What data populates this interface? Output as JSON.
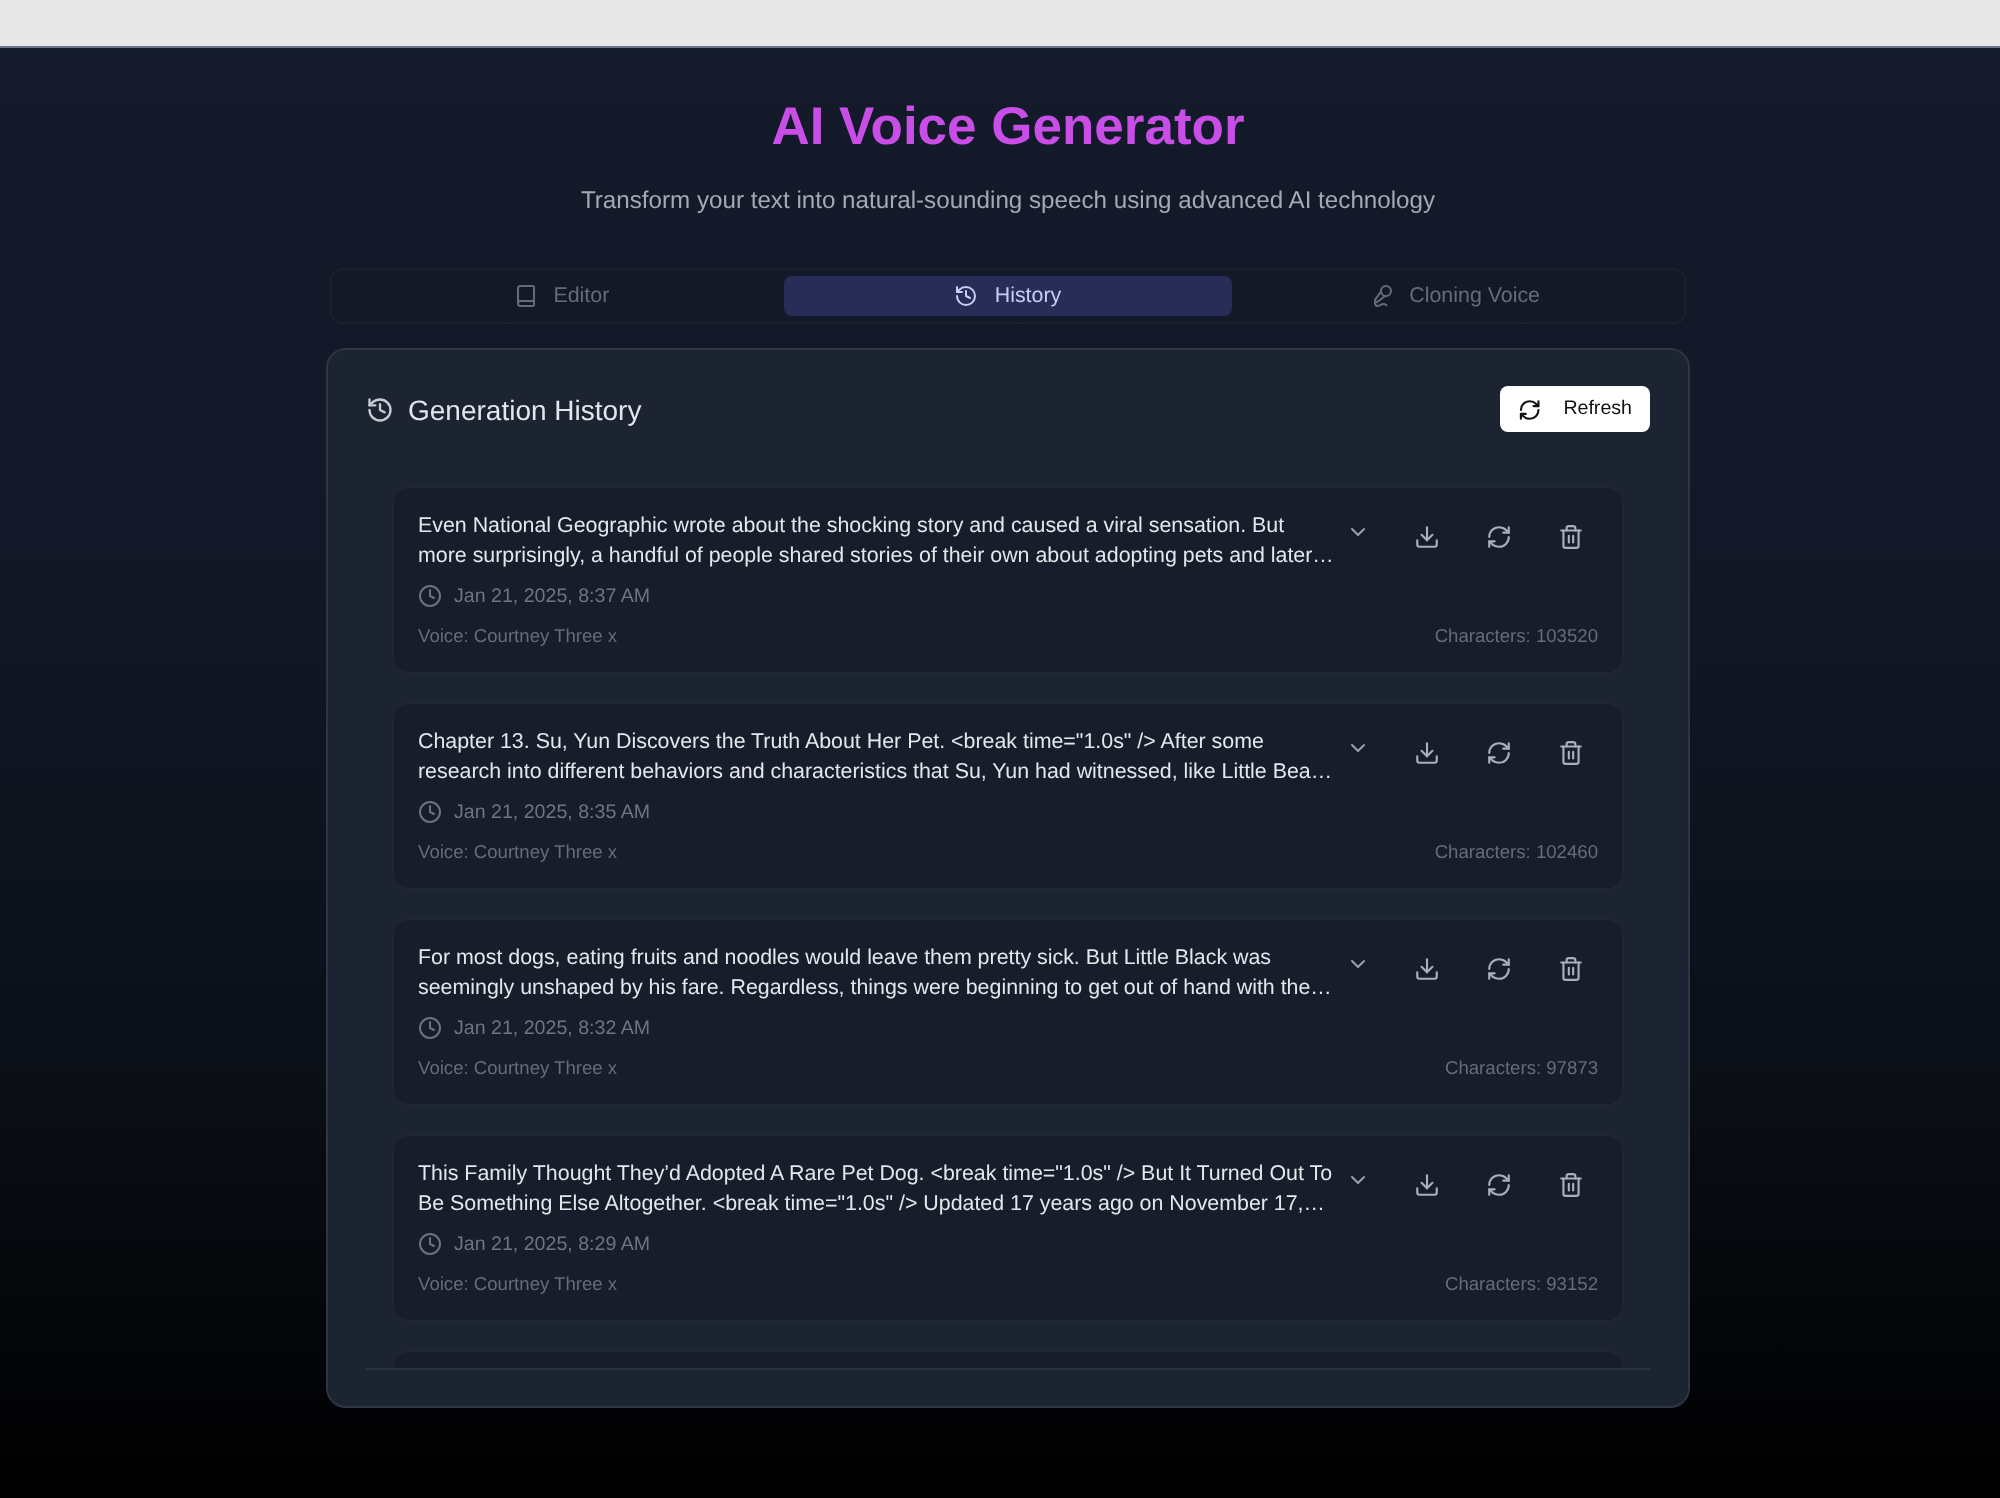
{
  "header": {
    "title": "AI Voice Generator",
    "subtitle": "Transform your text into natural-sounding speech using advanced AI technology"
  },
  "tabs": [
    {
      "label": "Editor",
      "selected": false
    },
    {
      "label": "History",
      "selected": true
    },
    {
      "label": "Cloning Voice",
      "selected": false
    }
  ],
  "history": {
    "title": "Generation History",
    "refresh_button": "Refresh",
    "items": [
      {
        "text": "Even National Geographic wrote about the shocking story and caused a viral sensation. But\nmore surprisingly, a handful of people shared stories of their own about adopting pets and later…",
        "date": "Jan 21, 2025, 8:37 AM",
        "voice": "Voice: Courtney Three x",
        "characters": "Characters: 103520"
      },
      {
        "text": "Chapter 13. Su, Yun Discovers the Truth About Her Pet. <break time=\"1.0s\" /> After some\nresearch into different behaviors and characteristics that Su, Yun had witnessed, like Little Bea…",
        "date": "Jan 21, 2025, 8:35 AM",
        "voice": "Voice: Courtney Three x",
        "characters": "Characters: 102460"
      },
      {
        "text": "For most dogs, eating fruits and noodles would leave them pretty sick. But Little Black was\nseemingly unshaped by his fare. Regardless, things were beginning to get out of hand with the…",
        "date": "Jan 21, 2025, 8:32 AM",
        "voice": "Voice: Courtney Three x",
        "characters": "Characters: 97873"
      },
      {
        "text": "This Family Thought They’d Adopted A Rare Pet Dog. <break time=\"1.0s\" /> But It Turned Out To\nBe Something Else Altogether. <break time=\"1.0s\" /> Updated 17 years ago on November 17,…",
        "date": "Jan 21, 2025, 8:29 AM",
        "voice": "Voice: Courtney Three x",
        "characters": "Characters: 93152"
      }
    ]
  }
}
